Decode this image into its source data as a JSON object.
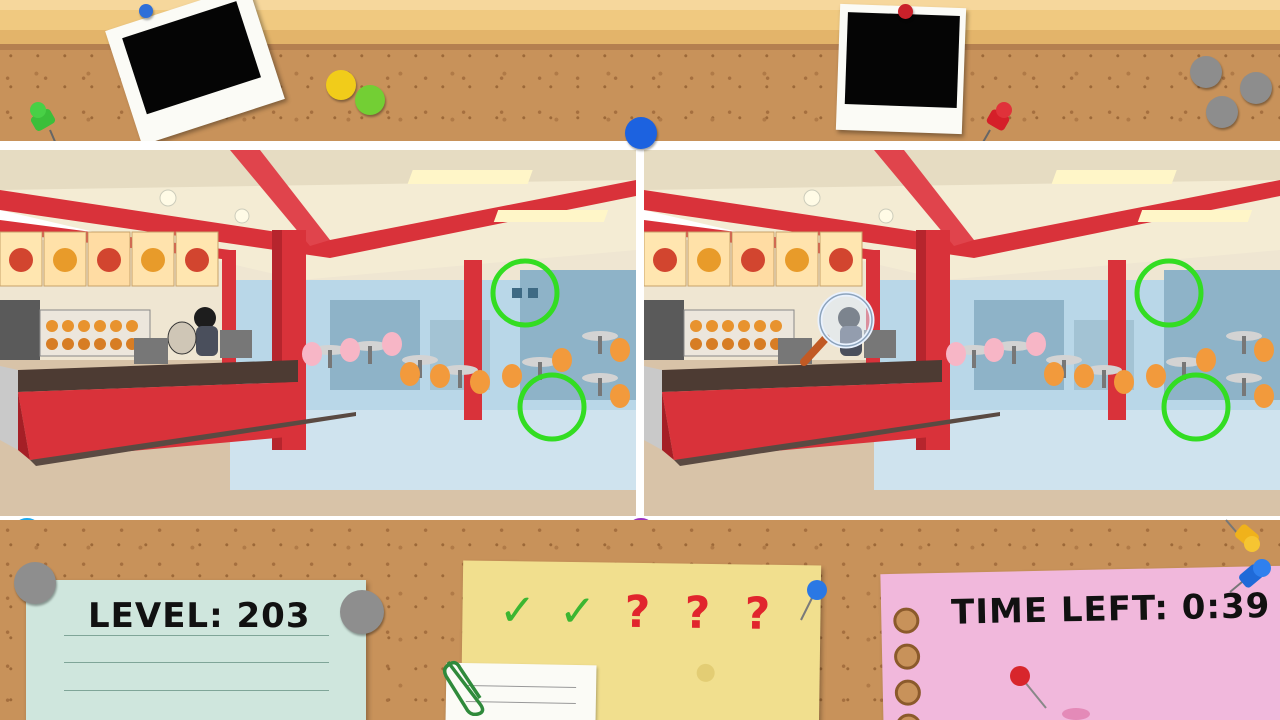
{
  "game": {
    "level_label": "LEVEL: 203",
    "time_left_label": "TIME LEFT: 0:39",
    "progress": {
      "found": 2,
      "total": 5,
      "marks": [
        {
          "state": "found",
          "glyph": "✓"
        },
        {
          "state": "found",
          "glyph": "✓"
        },
        {
          "state": "missing",
          "glyph": "?"
        },
        {
          "state": "missing",
          "glyph": "?"
        },
        {
          "state": "missing",
          "glyph": "?"
        }
      ]
    }
  },
  "scene": {
    "left_panel": "original-scene",
    "right_panel": "modified-scene",
    "icons": [
      "magnifier-icon",
      "found-difference-circle-icon",
      "push-pin-icon",
      "paper-clip-icon"
    ]
  },
  "colors": {
    "check": "#3cb631",
    "question": "#e1252d",
    "found_circle": "#33dd22",
    "counter_red": "#d9323a",
    "cork": "#c8925a"
  }
}
